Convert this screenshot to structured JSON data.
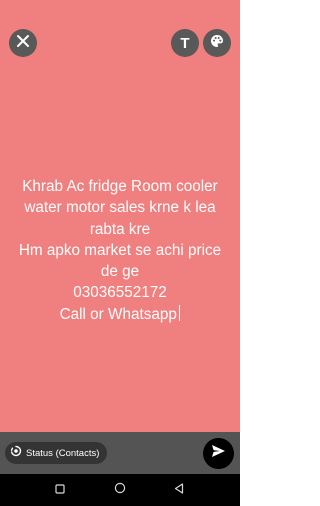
{
  "app": {
    "background_color": "#f07f7f"
  },
  "toolbar": {
    "close_icon": "close-icon",
    "text_tool_icon": "text-format-icon",
    "text_tool_label": "T",
    "color_tool_icon": "palette-icon"
  },
  "status_text": {
    "lines": [
      "Khrab Ac fridge Room cooler",
      "water motor sales krne k lea",
      "rabta kre",
      "Hm apko market se achi price",
      "de ge",
      "03036552172",
      "Call or Whatsapp"
    ],
    "text_color": "#ffffff"
  },
  "composer": {
    "audience_label": "Status (Contacts)",
    "audience_icon": "status-ring-icon",
    "send_icon": "send-icon"
  },
  "system_nav": {
    "recents_icon": "recents-square-icon",
    "home_icon": "home-circle-icon",
    "back_icon": "back-triangle-icon"
  }
}
